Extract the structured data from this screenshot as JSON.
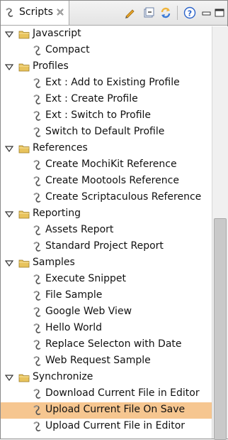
{
  "view": {
    "title": "Scripts",
    "tab_icon": "script-icon",
    "close_icon": "close-icon",
    "toolbar": [
      "edit-script-icon",
      "collapse-all-icon",
      "refresh-icon",
      "help-icon",
      "minimize-icon",
      "maximize-icon"
    ]
  },
  "tree": {
    "categories": [
      {
        "label": "Javascript",
        "items": [
          "Compact"
        ]
      },
      {
        "label": "Profiles",
        "items": [
          "Ext : Add to Existing Profile",
          "Ext : Create Profile",
          "Ext : Switch to Profile",
          "Switch to Default Profile"
        ]
      },
      {
        "label": "References",
        "items": [
          "Create MochiKit Reference",
          "Create Mootools Reference",
          "Create Scriptaculous Reference"
        ]
      },
      {
        "label": "Reporting",
        "items": [
          "Assets Report",
          "Standard Project Report"
        ]
      },
      {
        "label": "Samples",
        "items": [
          "Execute Snippet",
          "File Sample",
          "Google Web View",
          "Hello World",
          "Replace Selecton with Date",
          "Web Request Sample"
        ]
      },
      {
        "label": "Synchronize",
        "items": [
          "Download Current File in Editor",
          "Upload Current File On Save",
          "Upload Current File in Editor"
        ]
      }
    ],
    "selected": "Upload Current File On Save"
  },
  "colors": {
    "selection": "#f6c690",
    "folder": "#e8c35c",
    "pencil": "#e9a52a",
    "refresh": "#f0b43a",
    "help": "#2a62c9"
  }
}
